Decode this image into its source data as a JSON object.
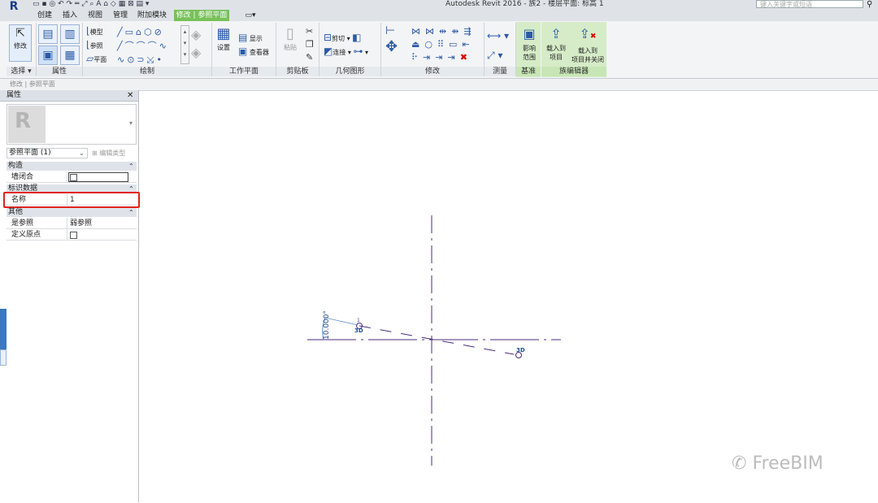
{
  "app": {
    "logo": "R",
    "title": "Autodesk Revit 2016 -    族2 - 楼层平面: 标高 1",
    "search_placeholder": "键入关键字或短语"
  },
  "tabs": [
    {
      "label": "创建"
    },
    {
      "label": "插入"
    },
    {
      "label": "视图"
    },
    {
      "label": "管理"
    },
    {
      "label": "附加模块"
    },
    {
      "label": "修改 | 参照平面"
    }
  ],
  "ribbon": {
    "select": {
      "button": "修改",
      "label": "选择 ▾"
    },
    "properties": {
      "label": "属性"
    },
    "draw": {
      "label": "绘制",
      "items": [
        "模型",
        "参照",
        "平面"
      ]
    },
    "workplane": {
      "label": "工作平面",
      "set": "设置",
      "show": "显示",
      "viewer": "查看器"
    },
    "clipboard": {
      "label": "剪贴板",
      "paste": "粘贴"
    },
    "geometry": {
      "label": "几何图形",
      "cut": "剪切",
      "join": "连接"
    },
    "modify": {
      "label": "修改"
    },
    "measure": {
      "label": "测量"
    },
    "datum": {
      "label": "基准",
      "influence": "影响\n范围"
    },
    "family_editor": {
      "label": "族编辑器",
      "load_project": "载入到\n项目",
      "load_close": "载入到\n项目并关闭"
    }
  },
  "options_bar": {
    "text": "修改 | 参照平面"
  },
  "properties": {
    "title": "属性",
    "type_selector": "参照平面 (1)",
    "edit_type": "编辑类型",
    "sections": [
      {
        "name": "构造"
      },
      {
        "name": "标识数据"
      },
      {
        "name": "其他"
      }
    ],
    "rows": {
      "closure": {
        "name": "墙闭合",
        "checked": false
      },
      "name": {
        "name": "名称",
        "value": "1"
      },
      "is_reference": {
        "name": "是参照",
        "value": "弱参照"
      },
      "defines_origin": {
        "name": "定义原点",
        "checked": false
      }
    }
  },
  "canvas": {
    "angle_label": "10.000°",
    "marker_top_label": "3D",
    "marker_top_num": "1",
    "marker_bottom_label": "3D"
  },
  "watermark": "FreeBIM",
  "colors": {
    "modify_tab": "#78c15a",
    "highlight": "#e0231d",
    "plane_line": "#4b2d7f"
  }
}
